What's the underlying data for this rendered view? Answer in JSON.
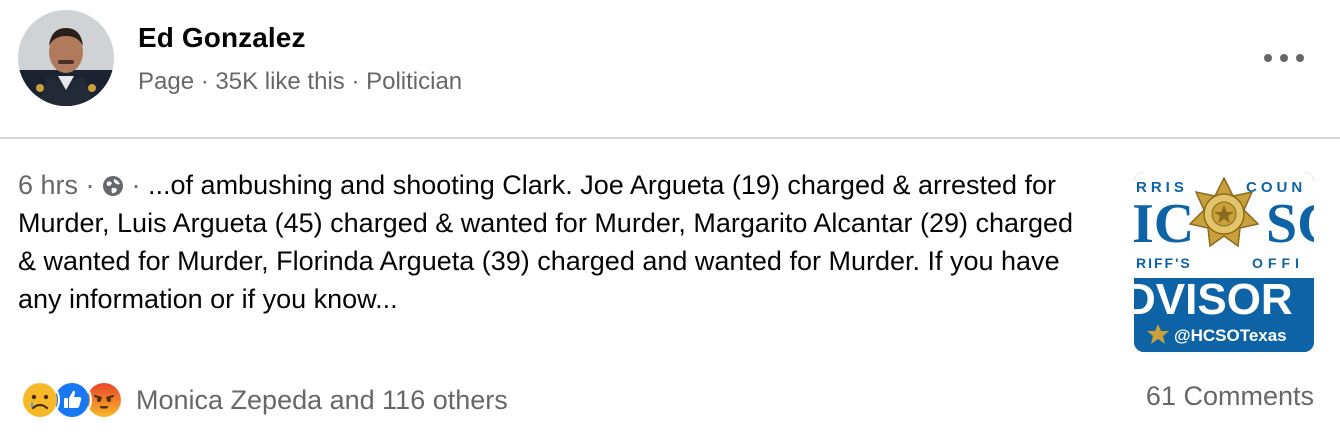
{
  "post": {
    "author": "Ed Gonzalez",
    "meta": "Page · 35K like this · Politician",
    "time": "6 hrs",
    "separator": " · ",
    "text": "...of ambushing and shooting Clark. Joe Argueta (19) charged & arrested for Murder, Luis Argueta (45) charged & wanted for Murder, Margarito Alcantar (29) charged & wanted for Murder, Florinda Argueta (39) charged and wanted for Murder. If you have any information or if you know...",
    "visibility_icon": "globe-icon"
  },
  "thumbnail": {
    "top_text_left": "RRIS",
    "top_text_right": "COUN",
    "letters_left": "IC",
    "letters_right": "SC",
    "mid_text_left": "RIFF'S",
    "mid_text_right": "OFFI",
    "big_word": "DVISOR",
    "handle": "@HCSOTexas",
    "colors": {
      "background": "#0d63a5",
      "band": "#ffffff",
      "badge": "#c9a13b"
    }
  },
  "footer": {
    "reactions": [
      "sad-icon",
      "like-icon",
      "angry-icon"
    ],
    "reaction_text": "Monica Zepeda and 116 others",
    "comments": "61 Comments"
  },
  "colors": {
    "secondary_text": "#65676b",
    "like_blue": "#1877f2",
    "angry_orange": "#f0592a",
    "sad_yellow": "#f7b928"
  }
}
